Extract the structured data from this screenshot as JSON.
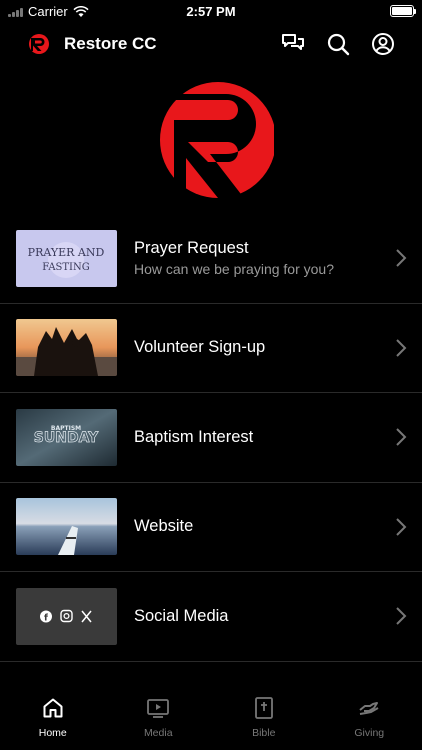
{
  "status_bar": {
    "carrier": "Carrier",
    "time": "2:57 PM"
  },
  "header": {
    "title": "Restore CC",
    "icons": [
      "chat-icon",
      "search-icon",
      "account-icon"
    ]
  },
  "brand": {
    "accent": "#e8171b"
  },
  "items": [
    {
      "title": "Prayer Request",
      "subtitle": "How can we be praying for you?",
      "thumb_text": "PRAYER AND\nFASTING"
    },
    {
      "title": "Volunteer Sign-up",
      "subtitle": ""
    },
    {
      "title": "Baptism Interest",
      "subtitle": "",
      "thumb_text_small": "BAPTISM",
      "thumb_text_large": "SUNDAY"
    },
    {
      "title": "Website",
      "subtitle": ""
    },
    {
      "title": "Social Media",
      "subtitle": ""
    }
  ],
  "tabs": [
    {
      "label": "Home",
      "icon": "home-icon",
      "active": true
    },
    {
      "label": "Media",
      "icon": "media-icon",
      "active": false
    },
    {
      "label": "Bible",
      "icon": "bible-icon",
      "active": false
    },
    {
      "label": "Giving",
      "icon": "giving-icon",
      "active": false
    }
  ]
}
